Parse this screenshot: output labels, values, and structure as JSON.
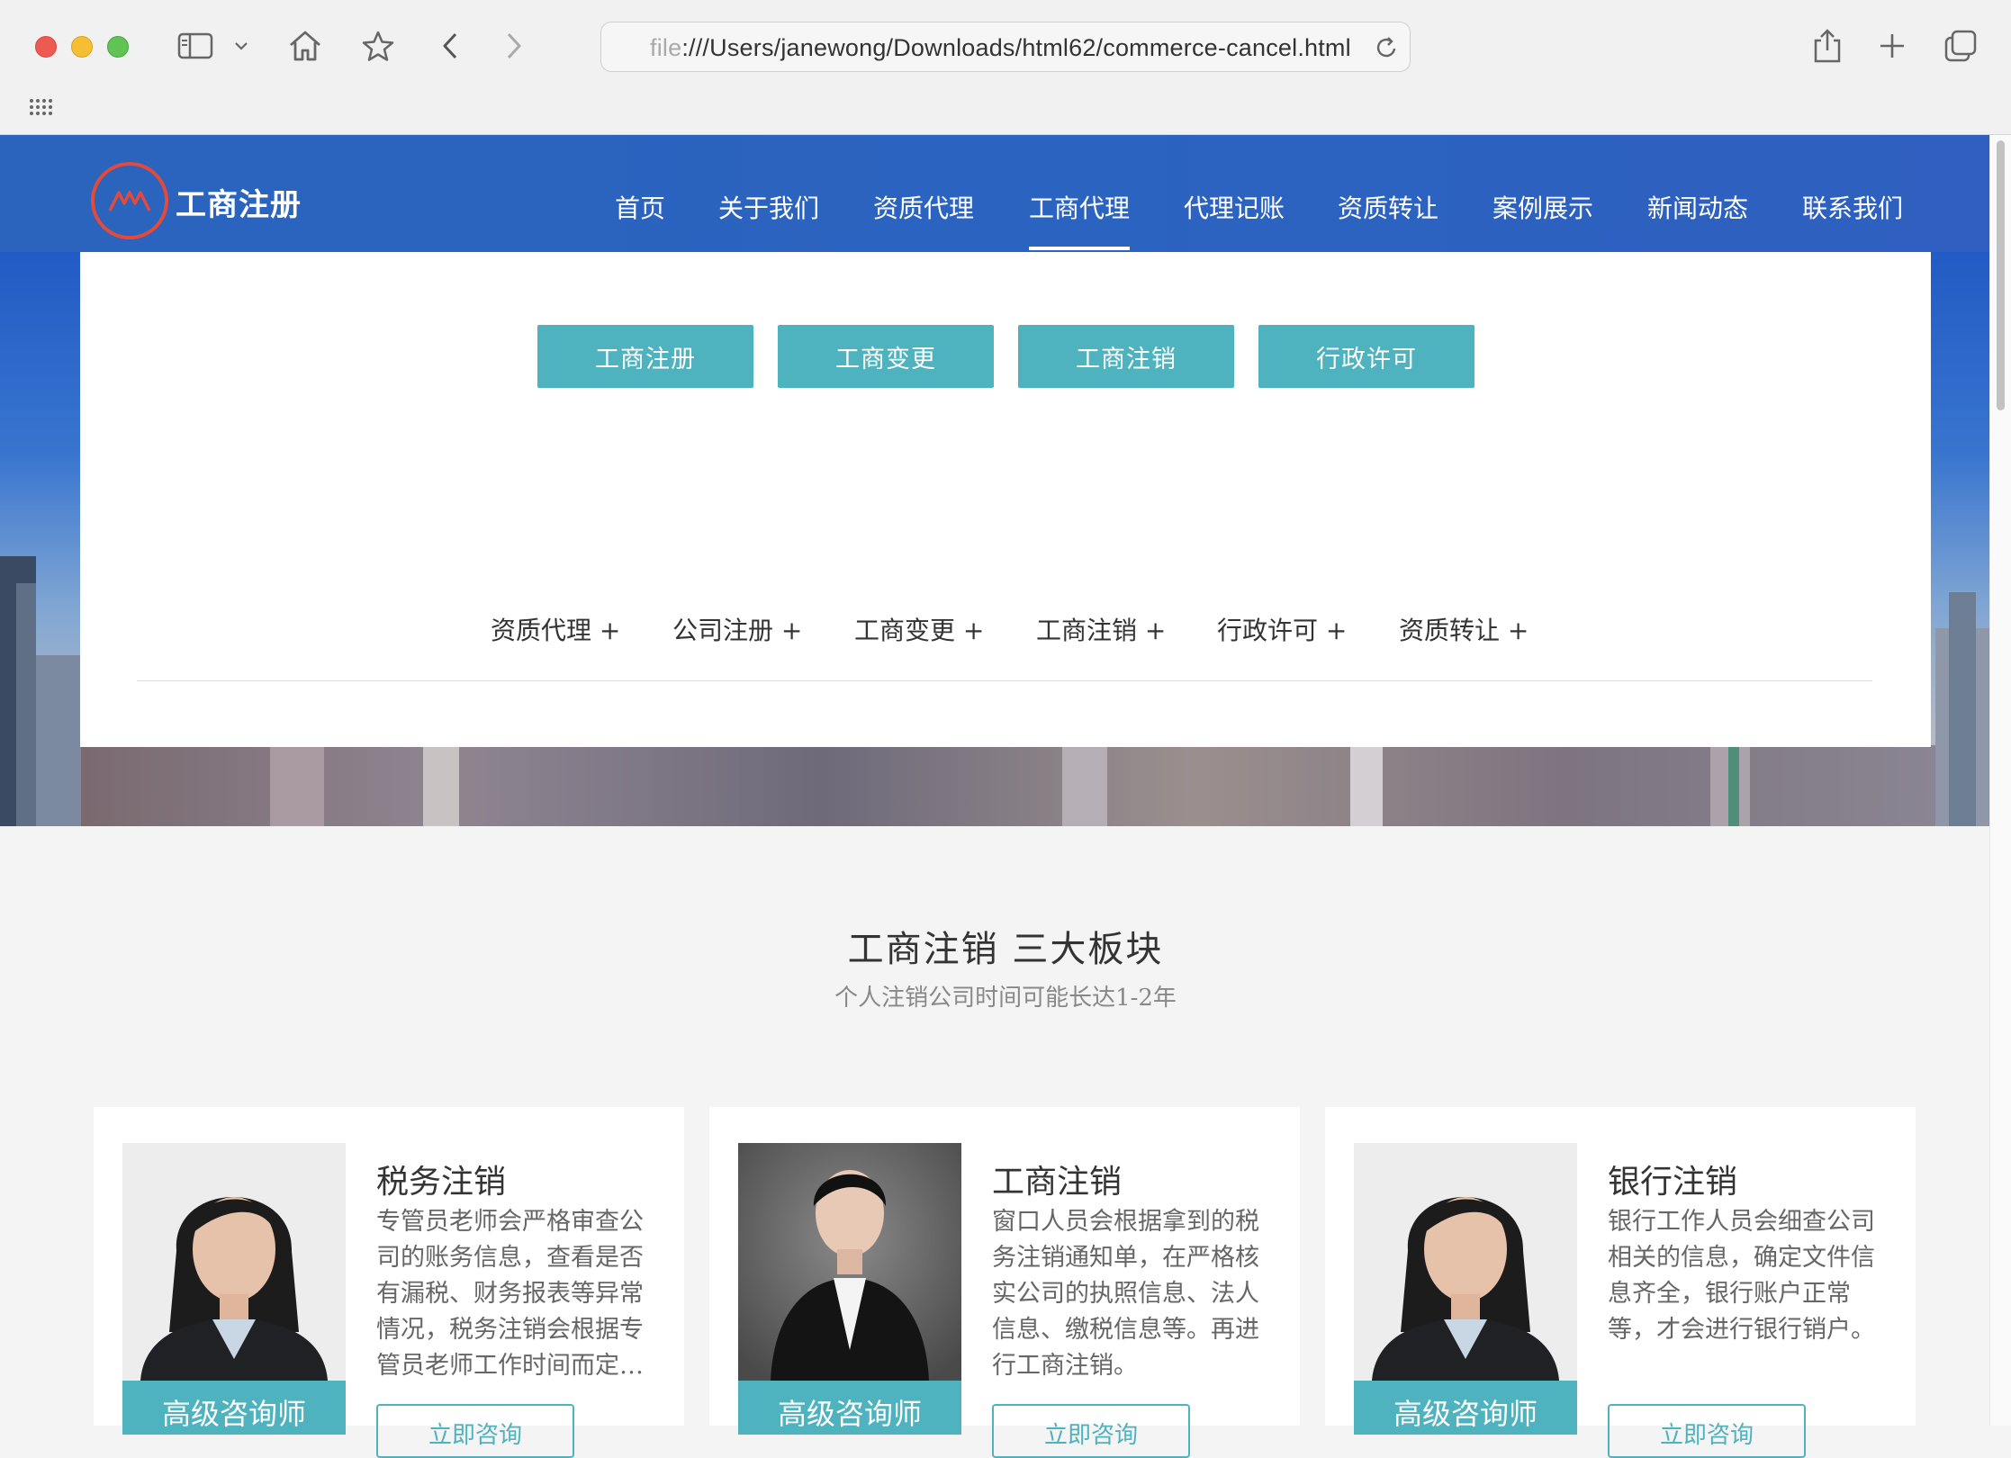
{
  "browser": {
    "url_faded": "file",
    "url": ":///Users/janewong/Downloads/html62/commerce-cancel.html"
  },
  "site": {
    "logo_text": "工商注册",
    "nav": [
      {
        "label": "首页"
      },
      {
        "label": "关于我们"
      },
      {
        "label": "资质代理"
      },
      {
        "label": "工商代理"
      },
      {
        "label": "代理记账"
      },
      {
        "label": "资质转让"
      },
      {
        "label": "案例展示"
      },
      {
        "label": "新闻动态"
      },
      {
        "label": "联系我们"
      }
    ]
  },
  "panel": {
    "tabs": [
      "工商注册",
      "工商变更",
      "工商注销",
      "行政许可"
    ],
    "categories": [
      "资质代理 +",
      "公司注册 +",
      "工商变更 +",
      "工商注销 +",
      "行政许可 +",
      "资质转让 +"
    ]
  },
  "section": {
    "title": "工商注销 三大板块",
    "subtitle": "个人注销公司时间可能长达1-2年"
  },
  "cards": [
    {
      "title": "税务注销",
      "desc": "专管员老师会严格审查公司的账务信息，查看是否有漏税、财务报表等异常情况，税务注销会根据专管员老师工作时间而定…",
      "badge": "高级咨询师",
      "button": "立即咨询"
    },
    {
      "title": "工商注销",
      "desc": "窗口人员会根据拿到的税务注销通知单，在严格核实公司的执照信息、法人信息、缴税信息等。再进行工商注销。",
      "badge": "高级咨询师",
      "button": "立即咨询"
    },
    {
      "title": "银行注销",
      "desc": "银行工作人员会细查公司相关的信息，确定文件信息齐全，银行账户正常等，才会进行银行销户。",
      "badge": "高级咨询师",
      "button": "立即咨询"
    }
  ],
  "colors": {
    "header_blue": "#2b63c0",
    "accent_teal": "#4eb3be"
  }
}
